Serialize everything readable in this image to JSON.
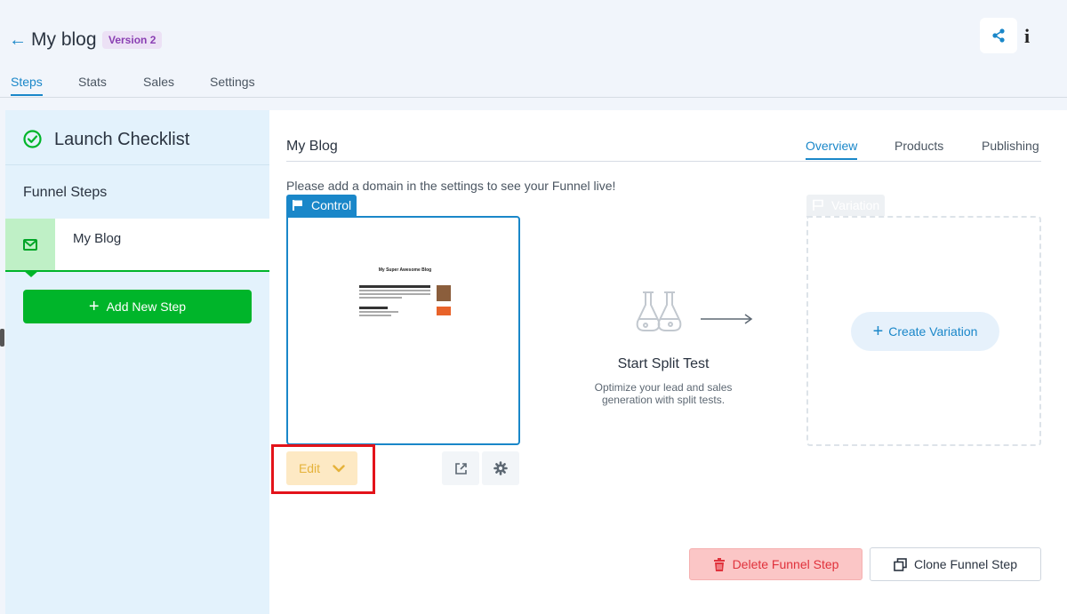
{
  "header": {
    "back_icon": "arrow-left-icon",
    "title": "My blog",
    "version_badge": "Version 2",
    "share_icon": "share-icon",
    "info_icon": "info-icon",
    "info_glyph": "i",
    "tabs": [
      {
        "label": "Steps",
        "active": true
      },
      {
        "label": "Stats",
        "active": false
      },
      {
        "label": "Sales",
        "active": false
      },
      {
        "label": "Settings",
        "active": false
      }
    ]
  },
  "sidebar": {
    "launch_checklist": "Launch Checklist",
    "funnel_steps_heading": "Funnel Steps",
    "steps": [
      {
        "label": "My Blog",
        "icon": "envelope-icon"
      }
    ],
    "add_step_label": "Add New Step"
  },
  "content": {
    "title": "My Blog",
    "tabs": [
      {
        "label": "Overview",
        "active": true
      },
      {
        "label": "Products",
        "active": false
      },
      {
        "label": "Publishing",
        "active": false
      }
    ],
    "notice": "Please add a domain in the settings to see your Funnel live!",
    "control": {
      "tag_label": "Control",
      "preview_title": "My Super Awesome Blog",
      "edit_label": "Edit"
    },
    "split_test": {
      "title": "Start Split Test",
      "description": "Optimize your lead and sales generation with split tests."
    },
    "variation": {
      "tag_label": "Variation",
      "create_label": "Create Variation"
    },
    "delete_label": "Delete Funnel Step",
    "clone_label": "Clone Funnel Step"
  },
  "colors": {
    "accent": "#1a87c9",
    "success": "#00b52a",
    "danger": "#e0323c",
    "edit": "#e5b23a"
  }
}
